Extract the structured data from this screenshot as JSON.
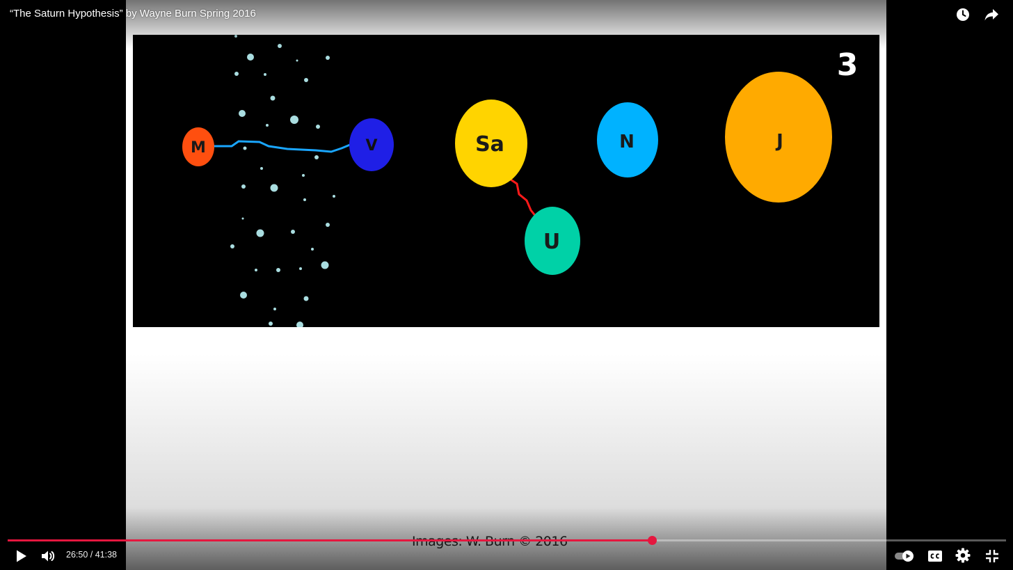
{
  "player": {
    "title": "“The Saturn Hypothesis” by Wayne Burn Spring 2016",
    "current_time": "26:50",
    "time_separator": " / ",
    "duration": "41:38",
    "progress_fraction": 0.645,
    "accent_color": "#e5173f"
  },
  "slide": {
    "slide_number": "3",
    "planets": [
      {
        "label": "M",
        "color": "#ff4f0f"
      },
      {
        "label": "V",
        "color": "#1f1fe6"
      },
      {
        "label": "Sa",
        "color": "#ffd400"
      },
      {
        "label": "N",
        "color": "#00b2ff"
      },
      {
        "label": "J",
        "color": "#ffaa00"
      },
      {
        "label": "U",
        "color": "#00d1a7"
      }
    ],
    "credit": "Images: W. Burn © 2016"
  },
  "controls": {
    "icons": [
      "watch-later-icon",
      "share-icon",
      "play-icon",
      "volume-icon",
      "autoplay-toggle-icon",
      "subtitles-icon",
      "settings-icon",
      "exit-fullscreen-icon"
    ]
  }
}
